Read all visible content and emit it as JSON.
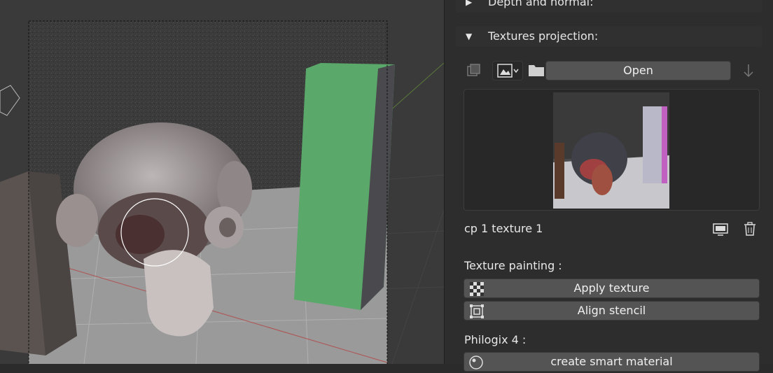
{
  "panel": {
    "depth_section": {
      "label": "Depth and normal:",
      "expanded": false
    },
    "textures_section": {
      "label": "Textures projection:",
      "expanded": true
    },
    "toolbar": {
      "open_label": "Open"
    },
    "texture_name": "cp 1 texture 1",
    "texture_painting": {
      "heading": "Texture painting :",
      "apply_label": "Apply texture",
      "align_label": "Align stencil"
    },
    "philogix": {
      "heading": "Philogix 4 :",
      "smart_label": "create smart material"
    }
  },
  "colors": {
    "panel_bg": "#2d2d2d",
    "button": "#545454",
    "green_box": "#5aa86a",
    "viewport_bg": "#3a3a3a"
  },
  "icons": [
    "copy-icon",
    "image-type-icon",
    "folder-icon",
    "down-arrow-icon",
    "display-icon",
    "trash-icon",
    "checker-icon",
    "stencil-icon",
    "material-ball-icon",
    "collapse-triangle",
    "expand-triangle"
  ]
}
